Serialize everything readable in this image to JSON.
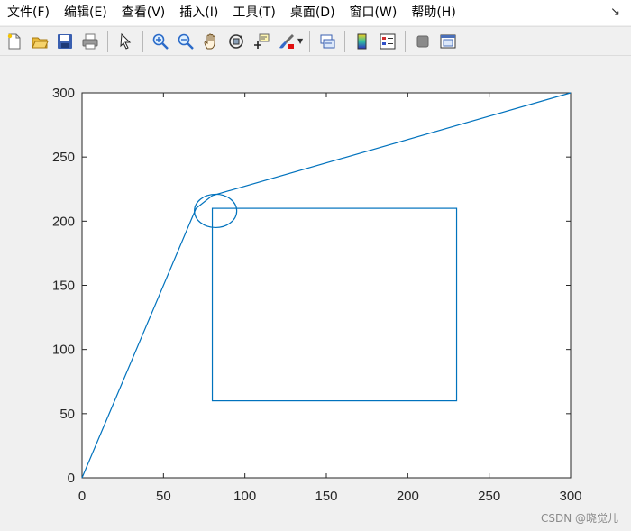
{
  "menubar": {
    "items": [
      "文件(F)",
      "编辑(E)",
      "查看(V)",
      "插入(I)",
      "工具(T)",
      "桌面(D)",
      "窗口(W)",
      "帮助(H)"
    ],
    "dock_glyph": "↘"
  },
  "toolbar": {
    "buttons": [
      "new-figure-icon",
      "open-file-icon",
      "save-icon",
      "print-icon",
      "pointer-icon",
      "zoom-in-icon",
      "zoom-out-icon",
      "pan-hand-icon",
      "rotate-3d-icon",
      "data-cursor-icon",
      "brush-icon",
      "link-plot-icon",
      "colorbar-icon",
      "legend-icon",
      "hide-plot-tools-icon",
      "show-plot-tools-icon"
    ]
  },
  "chart_data": {
    "type": "line",
    "xlim": [
      0,
      300
    ],
    "ylim": [
      0,
      300
    ],
    "xticks": [
      0,
      50,
      100,
      150,
      200,
      250,
      300
    ],
    "yticks": [
      0,
      50,
      100,
      150,
      200,
      250,
      300
    ],
    "tick_labels_x": [
      "0",
      "50",
      "100",
      "150",
      "200",
      "250",
      "300"
    ],
    "tick_labels_y": [
      "0",
      "50",
      "100",
      "150",
      "200",
      "250",
      "300"
    ],
    "line_color": "#0072bd",
    "series": [
      {
        "x": [
          0,
          70,
          80,
          300
        ],
        "y": [
          0,
          210,
          220,
          300
        ]
      }
    ],
    "rectangle": {
      "x": [
        80,
        230
      ],
      "y": [
        60,
        210
      ]
    },
    "ellipse": {
      "center": [
        82,
        208
      ],
      "rx": 13,
      "ry": 13
    },
    "grid": false
  },
  "watermark": "CSDN @晓觉儿"
}
